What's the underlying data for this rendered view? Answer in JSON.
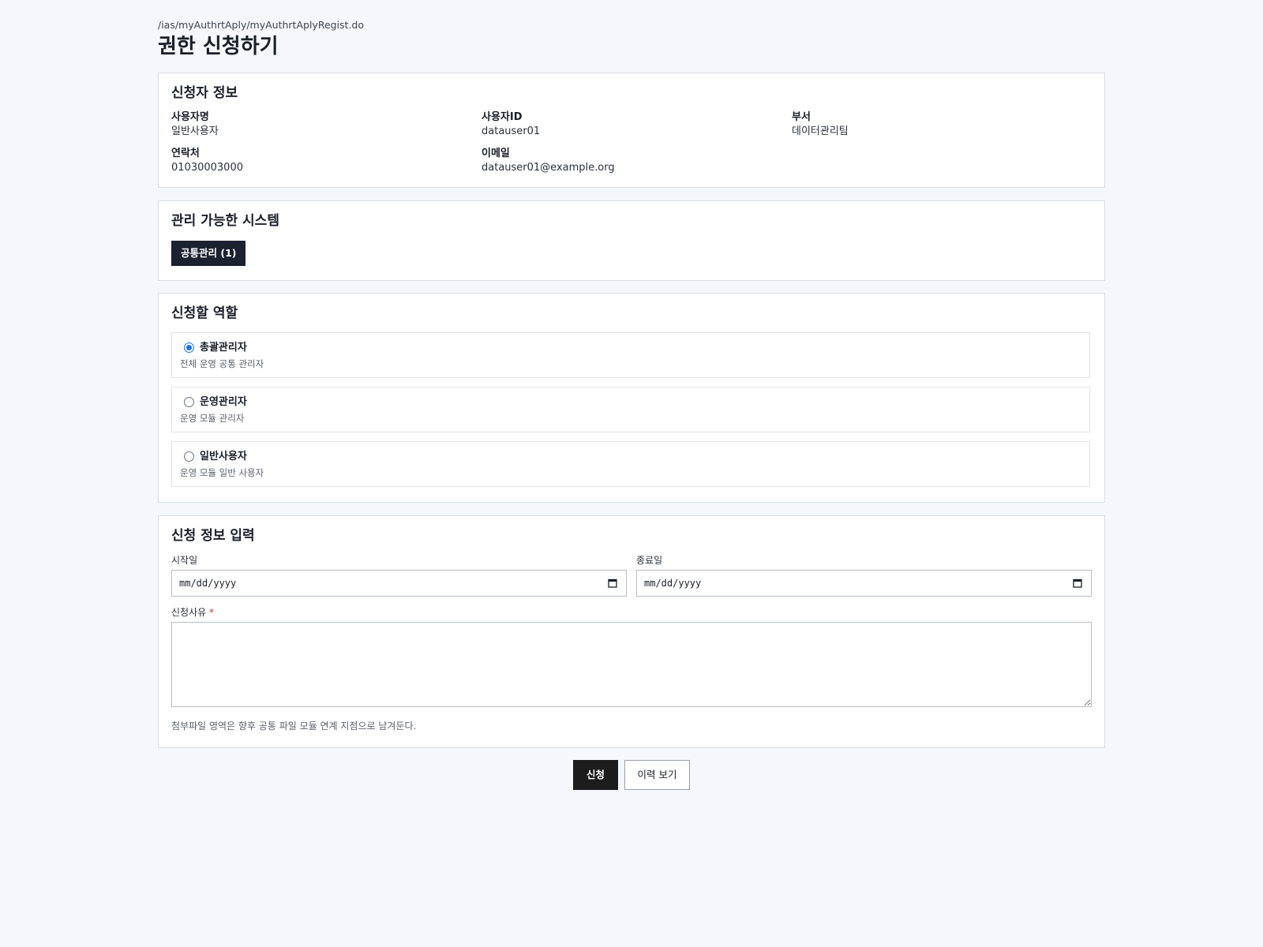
{
  "header": {
    "url_path": "/ias/myAuthrtAply/myAuthrtAplyRegist.do",
    "title": "권한 신청하기"
  },
  "applicant": {
    "title": "신청자 정보",
    "fields": [
      {
        "label": "사용자명",
        "value": "일반사용자"
      },
      {
        "label": "사용자ID",
        "value": "datauser01"
      },
      {
        "label": "부서",
        "value": "데이터관리팀"
      },
      {
        "label": "연락처",
        "value": "01030003000"
      },
      {
        "label": "이메일",
        "value": "datauser01@example.org"
      }
    ]
  },
  "systems": {
    "title": "관리 가능한 시스템",
    "tabs": [
      {
        "label": "공통관리 (1)",
        "selected": true
      }
    ]
  },
  "roles": {
    "title": "신청할 역할",
    "options": [
      {
        "name": "총괄관리자",
        "desc": "전체 운영 공통 관리자",
        "checked": true
      },
      {
        "name": "운영관리자",
        "desc": "운영 모듈 관리자",
        "checked": false
      },
      {
        "name": "일반사용자",
        "desc": "운영 모듈 일반 사용자",
        "checked": false
      }
    ]
  },
  "request_form": {
    "title": "신청 정보 입력",
    "start_label": "시작일",
    "start_placeholder": "mm/dd/yyyy",
    "end_label": "종료일",
    "end_placeholder": "mm/dd/yyyy",
    "reason_label": "신청사유",
    "required_mark": "*",
    "reason_value": "",
    "note": "첨부파일 영역은 향후 공통 파일 모듈 연계 지점으로 남겨둔다."
  },
  "actions": {
    "submit_label": "신청",
    "history_label": "이력 보기"
  },
  "colors": {
    "page_background": "#f6f7fb",
    "dark_button": "#1c1c1c",
    "system_tab": "#1c2130",
    "radio_accent": "#1a73e8",
    "required": "#d93025"
  }
}
